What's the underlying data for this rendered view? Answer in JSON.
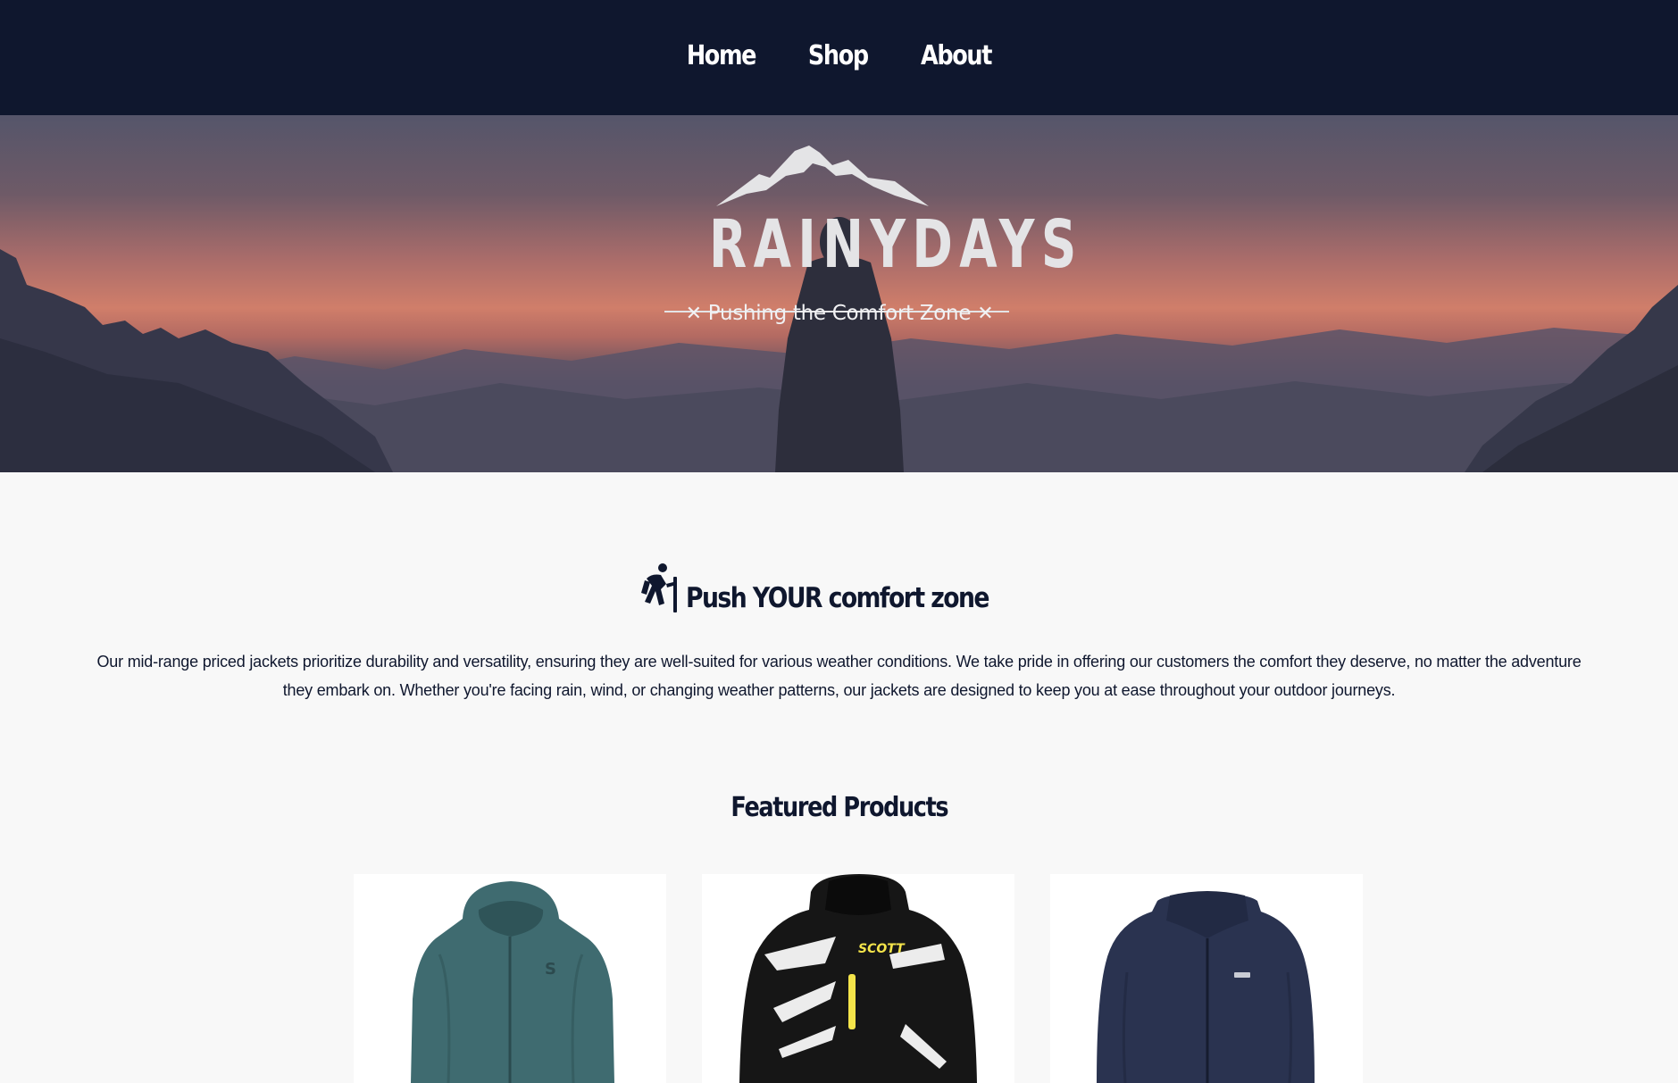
{
  "nav": {
    "items": [
      {
        "label": "Home"
      },
      {
        "label": "Shop"
      },
      {
        "label": "About"
      }
    ]
  },
  "hero": {
    "logo_text": "RAINYDAYS",
    "tagline": "Pushing the Comfort Zone"
  },
  "intro": {
    "icon": "hiking-icon",
    "heading": "Push YOUR comfort zone",
    "body": "Our mid-range priced jackets prioritize durability and versatility, ensuring they are well-suited for various weather conditions. We take pride in offering our customers the comfort they deserve, no matter the adventure they embark on. Whether you're facing rain, wind, or changing weather patterns, our jackets are designed to keep you at ease throughout your outdoor journeys."
  },
  "featured": {
    "title": "Featured Products",
    "products": [
      {
        "image": "teal-hooded-jacket"
      },
      {
        "image": "black-scott-racing-jacket",
        "brand": "SCOTT"
      },
      {
        "image": "navy-fleece-jacket"
      }
    ]
  },
  "colors": {
    "nav_background": "#0f172e",
    "text": "#0f172e",
    "page_background": "#f8f8f8",
    "card_background": "#ffffff"
  }
}
